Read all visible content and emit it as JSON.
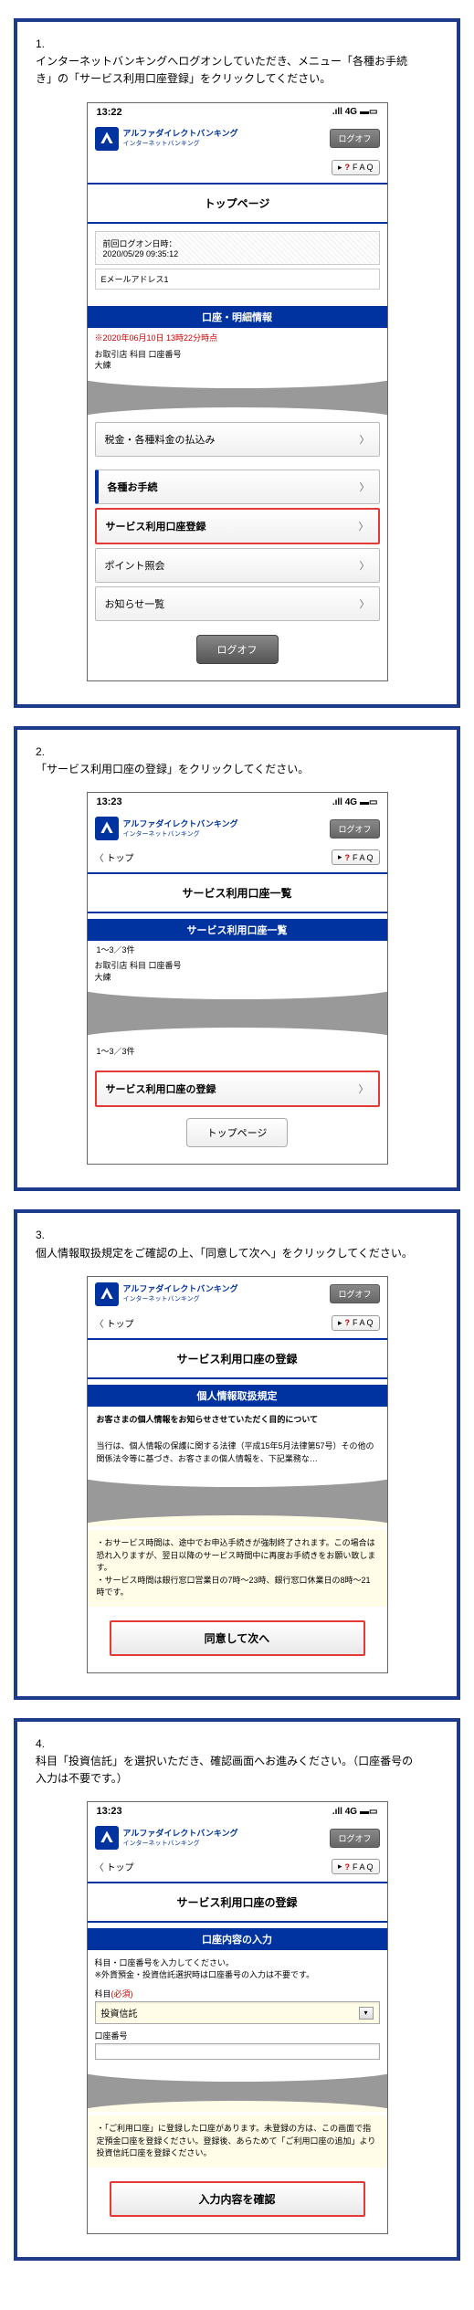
{
  "steps": [
    {
      "num": "1.",
      "text": "インターネットバンキングへログオンしていただき、メニュー「各種お手続き」の「サービス利用口座登録」をクリックしてください。",
      "time": "13:22",
      "signal": ".ıll 4G",
      "brand_line1": "アルファダイレクトバンキング",
      "brand_line2": "インターネットバンキング",
      "logoff": "ログオフ",
      "faq": "F A Q",
      "page_title": "トップページ",
      "login_info_line1": "前回ログオン日時：",
      "login_info_line2": "2020/05/29 09:35:12",
      "email_label": "Eメールアドレス1",
      "section_bar": "口座・明細情報",
      "timestamp": "※2020年06月10日 13時22分時点",
      "account_info": "お取引店 科目 口座番号\n大練",
      "menu_payment": "税金・各種料金の払込み",
      "menu_procedures": "各種お手続",
      "menu_service_reg": "サービス利用口座登録",
      "menu_points": "ポイント照会",
      "menu_notices": "お知らせ一覧",
      "big_logoff": "ログオフ"
    },
    {
      "num": "2.",
      "text": "「サービス利用口座の登録」をクリックしてください。",
      "time": "13:23",
      "top_link": "トップ",
      "page_title": "サービス利用口座一覧",
      "section_bar": "サービス利用口座一覧",
      "pagination_top": "1～3／3件",
      "account_info": "お取引店 科目 口座番号\n大練",
      "pagination_bottom": "1～3／3件",
      "menu_register": "サービス利用口座の登録",
      "btn_toppage": "トップページ"
    },
    {
      "num": "3.",
      "text": "個人情報取扱規定をご確認の上、「同意して次へ」をクリックしてください。",
      "top_link": "トップ",
      "page_title": "サービス利用口座の登録",
      "section_bar": "個人情報取扱規定",
      "intro_bold": "お客さまの個人情報をお知らせさせていただく目的について",
      "intro_body": "当行は、個人情報の保護に関する法律（平成15年5月法律第57号）その他の関係法令等に基づき、お客さまの個人情報を、下記業務な…",
      "yellow_text": "・おサービス時間は、途中でお申込手続きが強制終了されます。この場合は恐れ入りますが、翌日以降のサービス時間中に再度お手続きをお願い致します。\n・サービス時間は銀行窓口営業日の7時～23時、銀行窓口休業日の8時～21時です。",
      "agree_btn": "同意して次へ"
    },
    {
      "num": "4.",
      "text": "科目「投資信託」を選択いただき、確認画面へお進みください。（口座番号の入力は不要です。）",
      "time": "13:23",
      "top_link": "トップ",
      "page_title": "サービス利用口座の登録",
      "section_bar": "口座内容の入力",
      "form_note": "科目・口座番号を入力してください。\n※外貨預金・投資信託選択時は口座番号の入力は不要です。",
      "label_subject": "科目",
      "req": "(必須)",
      "select_value": "投資信託",
      "label_account": "口座番号",
      "yellow_text": "・「ご利用口座」に登録した口座があります。未登録の方は、この画面で指定預金口座を登録ください。登録後、あらためて「ご利用口座の追加」より投資信託口座を登録ください。",
      "confirm_btn": "入力内容を確認"
    }
  ]
}
